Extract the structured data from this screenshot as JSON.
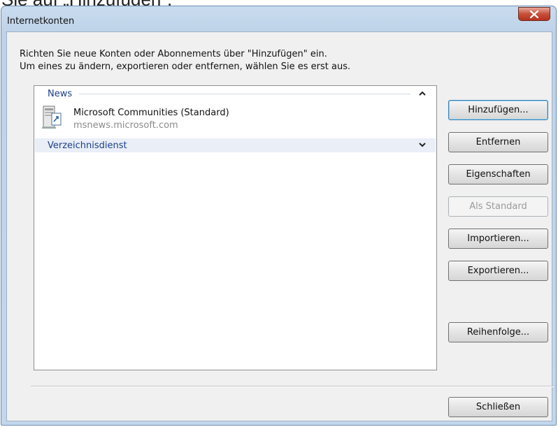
{
  "background_text": "Sie auf „Hinzufügen“.",
  "window": {
    "title": "Internetkonten"
  },
  "intro": {
    "line1": "Richten Sie neue Konten oder Abonnements über \"Hinzufügen\" ein.",
    "line2": "Um eines zu ändern, exportieren oder entfernen, wählen Sie es erst aus."
  },
  "list": {
    "groups": [
      {
        "label": "News",
        "state": "expanded",
        "items": [
          {
            "name": "Microsoft Communities (Standard)",
            "server": "msnews.microsoft.com",
            "icon": "news-server-icon"
          }
        ]
      },
      {
        "label": "Verzeichnisdienst",
        "state": "collapsed",
        "items": []
      }
    ]
  },
  "buttons": {
    "add": "Hinzufügen...",
    "remove": "Entfernen",
    "properties": "Eigenschaften",
    "set_default": "Als Standard",
    "import": "Importieren...",
    "export": "Exportieren...",
    "order": "Reihenfolge...",
    "close": "Schließen"
  },
  "colors": {
    "group_header_text": "#1c3f8a",
    "close_button": "#c7503a"
  }
}
